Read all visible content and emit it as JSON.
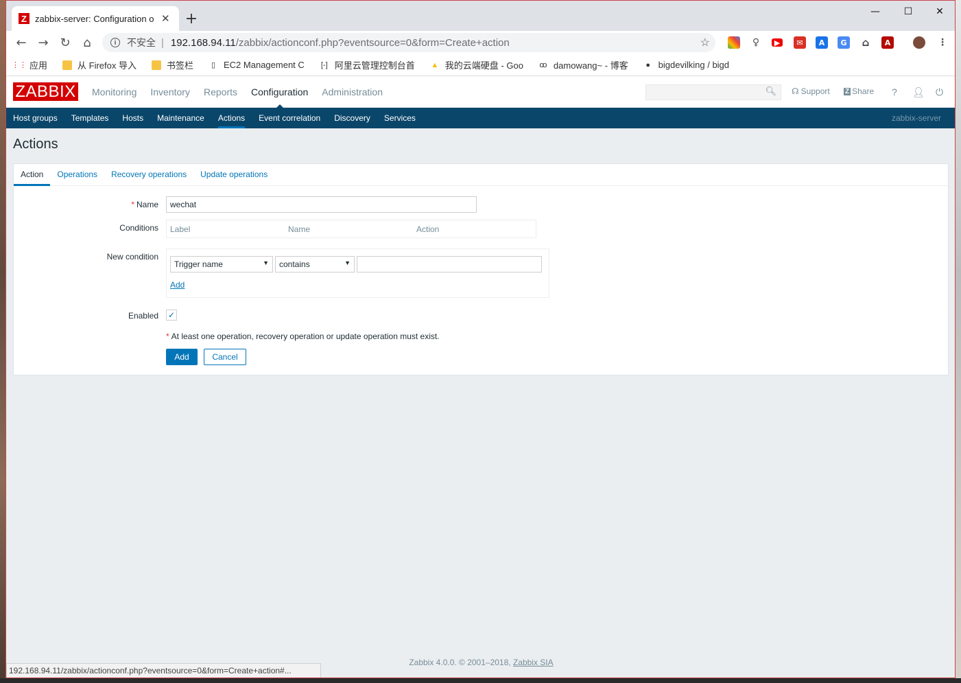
{
  "browser": {
    "tab_title": "zabbix-server: Configuration o",
    "new_tab": "+",
    "url_insecure": "不安全",
    "url_host": "192.168.94.11",
    "url_path": "/zabbix/actionconf.php?eventsource=0&form=Create+action",
    "bookmarks": [
      "应用",
      "从 Firefox 导入",
      "书签栏",
      "EC2 Management C",
      "阿里云管理控制台首",
      "我的云端硬盘 - Goo",
      "damowang~ - 博客",
      "bigdevilking / bigd"
    ],
    "status_url": "192.168.94.11/zabbix/actionconf.php?eventsource=0&form=Create+action#..."
  },
  "zabbix": {
    "logo": "ZABBIX",
    "menu": [
      "Monitoring",
      "Inventory",
      "Reports",
      "Configuration",
      "Administration"
    ],
    "support": "Support",
    "share": "Share",
    "help": "?",
    "submenu": [
      "Host groups",
      "Templates",
      "Hosts",
      "Maintenance",
      "Actions",
      "Event correlation",
      "Discovery",
      "Services"
    ],
    "server_name": "zabbix-server"
  },
  "page": {
    "title": "Actions",
    "tabs": [
      "Action",
      "Operations",
      "Recovery operations",
      "Update operations"
    ],
    "form": {
      "name_label": "Name",
      "name_value": "wechat",
      "conditions_label": "Conditions",
      "conditions_headers": [
        "Label",
        "Name",
        "Action"
      ],
      "new_condition_label": "New condition",
      "condition_type": "Trigger name",
      "condition_operator": "contains",
      "condition_value": "",
      "add_link": "Add",
      "enabled_label": "Enabled",
      "enabled_checked": "✓",
      "note": "At least one operation, recovery operation or update operation must exist.",
      "add_button": "Add",
      "cancel_button": "Cancel"
    }
  },
  "footer": {
    "text": "Zabbix 4.0.0. © 2001–2018, ",
    "company": "Zabbix SIA"
  }
}
